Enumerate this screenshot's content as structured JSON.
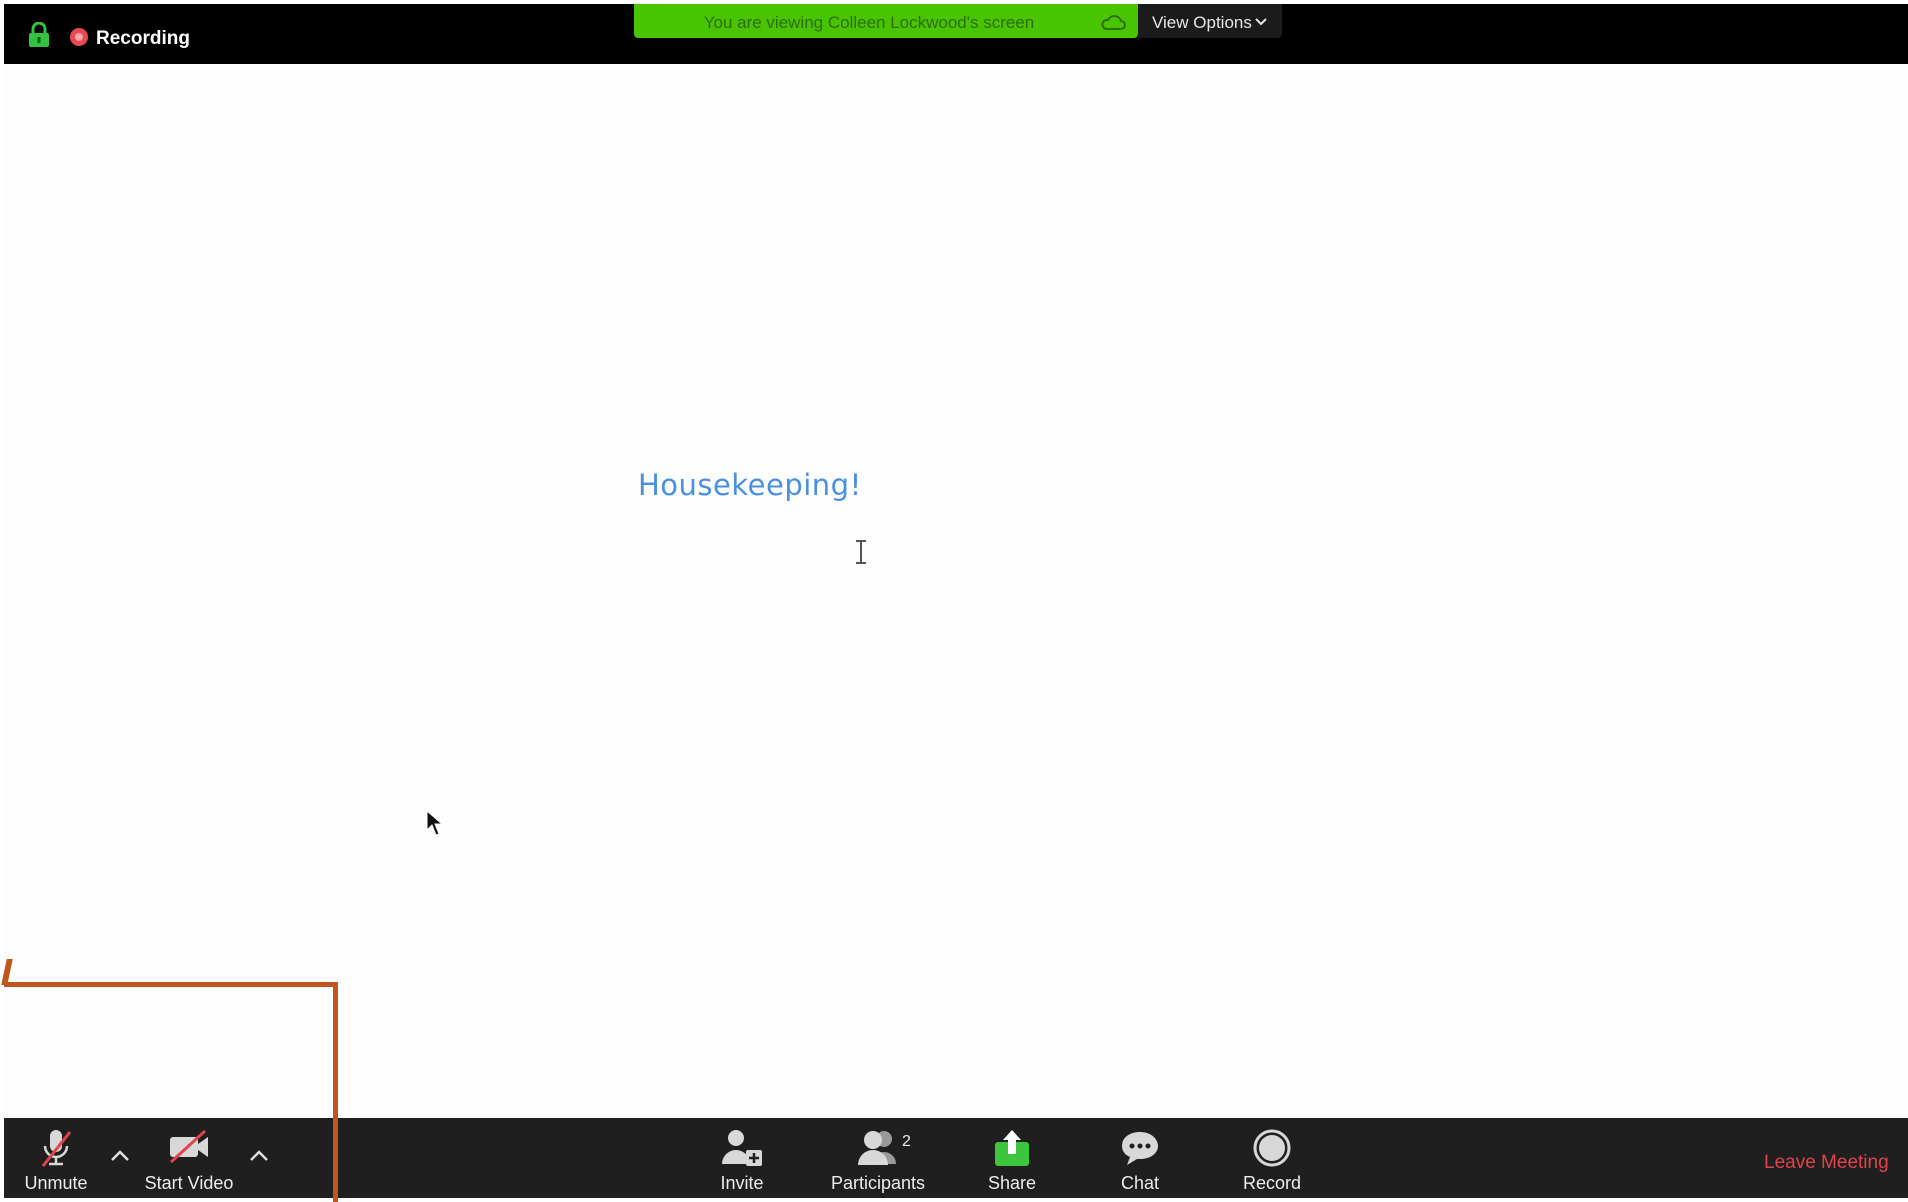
{
  "top_bar": {
    "recording_label": "Recording",
    "viewing_banner": "You are viewing Colleen Lockwood's screen",
    "view_options_label": "View Options"
  },
  "shared_screen": {
    "title": "Housekeeping!"
  },
  "toolbar": {
    "unmute_label": "Unmute",
    "start_video_label": "Start Video",
    "invite_label": "Invite",
    "participants_label": "Participants",
    "participants_count": "2",
    "share_label": "Share",
    "chat_label": "Chat",
    "record_label": "Record",
    "leave_label": "Leave Meeting"
  },
  "icons": {
    "lock": "lock-icon",
    "recording": "recording-dot-icon",
    "cloud": "cloud-icon",
    "mic_muted": "microphone-muted-icon",
    "video_off": "video-off-icon",
    "caret": "caret-up-icon",
    "invite": "add-person-icon",
    "participants": "participants-icon",
    "share": "share-upload-icon",
    "chat": "chat-bubble-icon",
    "record": "record-circle-icon"
  },
  "colors": {
    "banner_green": "#48c400",
    "leave_red": "#e2434b",
    "slide_title_blue": "#4a90e2",
    "annotation_orange": "#c0561b"
  }
}
